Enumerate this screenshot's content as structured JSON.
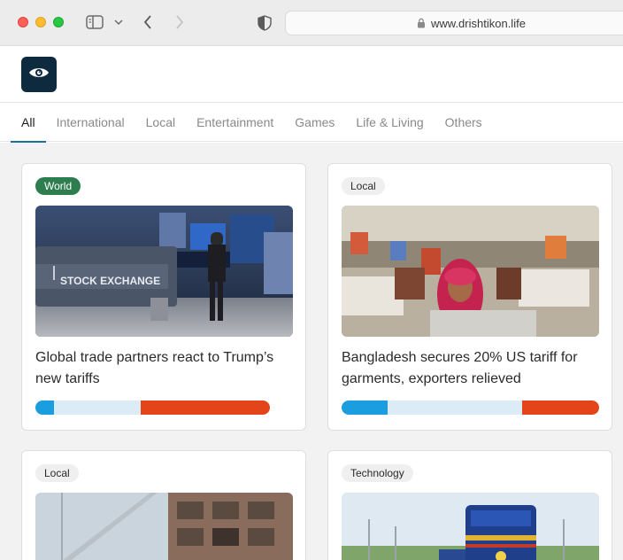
{
  "browser": {
    "url": "www.drishtikon.life"
  },
  "nav": {
    "tabs": [
      {
        "label": "All"
      },
      {
        "label": "International"
      },
      {
        "label": "Local"
      },
      {
        "label": "Entertainment"
      },
      {
        "label": "Games"
      },
      {
        "label": "Life & Living"
      },
      {
        "label": "Others"
      }
    ],
    "active_tab": "All"
  },
  "articles": [
    {
      "category": "World",
      "title": "Global trade partners react to Trump’s new tariffs",
      "image_text": "STOCK EXCHANGE",
      "bias": {
        "left": 0.08,
        "center": 0.37,
        "right": 0.55
      }
    },
    {
      "category": "Local",
      "title": "Bangladesh secures 20% US tariff for garments, exporters relieved",
      "bias": {
        "left": 0.18,
        "center": 0.52,
        "right": 0.3
      }
    },
    {
      "category": "Local"
    },
    {
      "category": "Technology"
    }
  ],
  "colors": {
    "bias_left": "#1a9ee0",
    "bias_center": "#dcecf7",
    "bias_right": "#e34419",
    "world_badge": "#2e7d4f",
    "logo_bg": "#0e2a3f"
  }
}
